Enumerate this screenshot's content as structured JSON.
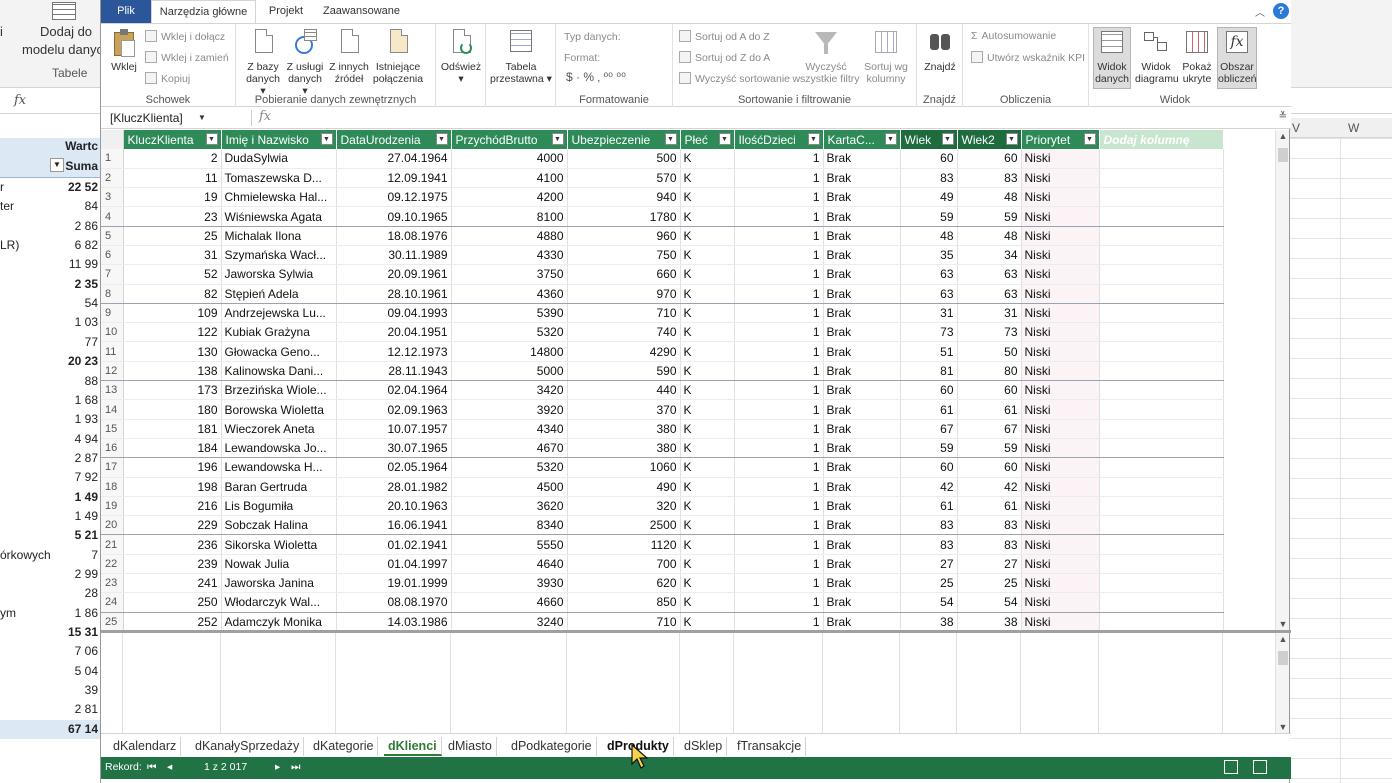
{
  "background": {
    "ribbon_partial_label": "i",
    "ribbon_button_line1": "Dodaj do",
    "ribbon_button_line2": "modelu danych",
    "ribbon_group": "Tabele",
    "fx": "fx",
    "col_w": "W",
    "pivot_header1": "Wartc",
    "pivot_header2": "Suma",
    "pivot_rows": [
      {
        "label": "r",
        "value": "22 52",
        "bold": true
      },
      {
        "label": "ter",
        "value": "84",
        "bold": false
      },
      {
        "label": "",
        "value": "2 86",
        "bold": false
      },
      {
        "label": "LR)",
        "value": "6 82",
        "bold": false
      },
      {
        "label": "",
        "value": "11 99",
        "bold": false
      },
      {
        "label": "",
        "value": "2 35",
        "bold": true
      },
      {
        "label": "",
        "value": "54",
        "bold": false
      },
      {
        "label": "",
        "value": "1 03",
        "bold": false
      },
      {
        "label": "",
        "value": "77",
        "bold": false
      },
      {
        "label": "",
        "value": "20 23",
        "bold": true
      },
      {
        "label": "",
        "value": "88",
        "bold": false
      },
      {
        "label": "",
        "value": "1 68",
        "bold": false
      },
      {
        "label": "",
        "value": "1 93",
        "bold": false
      },
      {
        "label": "",
        "value": "4 94",
        "bold": false
      },
      {
        "label": "",
        "value": "2 87",
        "bold": false
      },
      {
        "label": "",
        "value": "7 92",
        "bold": false
      },
      {
        "label": "",
        "value": "1 49",
        "bold": true
      },
      {
        "label": "",
        "value": "1 49",
        "bold": false
      },
      {
        "label": "",
        "value": "5 21",
        "bold": true
      },
      {
        "label": "órkowych",
        "value": "7",
        "bold": false
      },
      {
        "label": "",
        "value": "2 99",
        "bold": false
      },
      {
        "label": "",
        "value": "28",
        "bold": false
      },
      {
        "label": "ym",
        "value": "1 86",
        "bold": false
      },
      {
        "label": "",
        "value": "15 31",
        "bold": true
      },
      {
        "label": "",
        "value": "7 06",
        "bold": false
      },
      {
        "label": "",
        "value": "5 04",
        "bold": false
      },
      {
        "label": "",
        "value": "39",
        "bold": false
      },
      {
        "label": "",
        "value": "2 81",
        "bold": false
      },
      {
        "label": "",
        "value": "67 14",
        "bold": true
      }
    ]
  },
  "tabs": {
    "plik": "Plik",
    "home": "Narzędzia główne",
    "projekt": "Projekt",
    "zaawansowane": "Zaawansowane"
  },
  "ribbon": {
    "schowek": {
      "label": "Schowek",
      "wklej": "Wklej",
      "wklej_dolacz": "Wklej i dołącz",
      "wklej_zamien": "Wklej i zamień",
      "kopiuj": "Kopiuj"
    },
    "pobieranie": {
      "label": "Pobieranie danych zewnętrznych",
      "z_bazy": [
        "Z bazy",
        "danych"
      ],
      "z_uslugi": [
        "Z usługi",
        "danych"
      ],
      "z_innych": [
        "Z innych",
        "źródeł"
      ],
      "istniejace": [
        "Istniejące",
        "połączenia"
      ]
    },
    "odswiez": "Odśwież",
    "tabela": [
      "Tabela",
      "przestawna"
    ],
    "formatowanie": {
      "label": "Formatowanie",
      "typ": "Typ danych:",
      "format": "Format:",
      "symbols": "$ · % ‚ ⁰⁰ ⁰⁰"
    },
    "sortowanie": {
      "label": "Sortowanie i filtrowanie",
      "az": "Sortuj od A do Z",
      "za": "Sortuj od Z do A",
      "wyczysc_sort": "Wyczyść sortowanie",
      "wyczysc_filtry": [
        "Wyczyść",
        "wszystkie filtry"
      ],
      "sortuj_wg": [
        "Sortuj wg",
        "kolumny"
      ]
    },
    "znajdz": {
      "label": "Znajdź",
      "btn": "Znajdź"
    },
    "obliczenia": {
      "label": "Obliczenia",
      "autosum": "Autosumowanie",
      "kpi": "Utwórz wskaźnik KPI"
    },
    "widok": {
      "label": "Widok",
      "danych": [
        "Widok",
        "danych"
      ],
      "diagramu": [
        "Widok",
        "diagramu"
      ],
      "ukryte": [
        "Pokaż",
        "ukryte"
      ],
      "obszar": [
        "Obszar",
        "obliczeń"
      ]
    }
  },
  "formula_bar": {
    "name_box": "[KluczKlienta]",
    "fx": "fx",
    "formula": ""
  },
  "columns": [
    "KluczKlienta",
    "Imię i Nazwisko",
    "DataUrodzenia",
    "PrzychódBrutto",
    "Ubezpieczenie",
    "Płeć",
    "IlośćDzieci",
    "KartaC...",
    "Wiek",
    "Wiek2",
    "Priorytet",
    "Dodaj kolumnę"
  ],
  "rows": [
    [
      "1",
      "2",
      "DudaSylwia",
      "27.04.1964",
      "4000",
      "500",
      "K",
      "1",
      "Brak",
      "60",
      "60",
      "Niski"
    ],
    [
      "2",
      "11",
      "Tomaszewska D...",
      "12.09.1941",
      "4100",
      "570",
      "K",
      "1",
      "Brak",
      "83",
      "83",
      "Niski"
    ],
    [
      "3",
      "19",
      "Chmielewska Hal...",
      "09.12.1975",
      "4200",
      "940",
      "K",
      "1",
      "Brak",
      "49",
      "48",
      "Niski"
    ],
    [
      "4",
      "23",
      "Wiśniewska Agata",
      "09.10.1965",
      "8100",
      "1780",
      "K",
      "1",
      "Brak",
      "59",
      "59",
      "Niski"
    ],
    [
      "5",
      "25",
      "Michalak Ilona",
      "18.08.1976",
      "4880",
      "960",
      "K",
      "1",
      "Brak",
      "48",
      "48",
      "Niski"
    ],
    [
      "6",
      "31",
      "Szymańska Wacł...",
      "30.11.1989",
      "4330",
      "750",
      "K",
      "1",
      "Brak",
      "35",
      "34",
      "Niski"
    ],
    [
      "7",
      "52",
      "Jaworska Sylwia",
      "20.09.1961",
      "3750",
      "660",
      "K",
      "1",
      "Brak",
      "63",
      "63",
      "Niski"
    ],
    [
      "8",
      "82",
      "Stępień Adela",
      "28.10.1961",
      "4360",
      "970",
      "K",
      "1",
      "Brak",
      "63",
      "63",
      "Niski"
    ],
    [
      "9",
      "109",
      "Andrzejewska Lu...",
      "09.04.1993",
      "5390",
      "710",
      "K",
      "1",
      "Brak",
      "31",
      "31",
      "Niski"
    ],
    [
      "10",
      "122",
      "Kubiak Grażyna",
      "20.04.1951",
      "5320",
      "740",
      "K",
      "1",
      "Brak",
      "73",
      "73",
      "Niski"
    ],
    [
      "11",
      "130",
      "Głowacka Geno...",
      "12.12.1973",
      "14800",
      "4290",
      "K",
      "1",
      "Brak",
      "51",
      "50",
      "Niski"
    ],
    [
      "12",
      "138",
      "Kalinowska Dani...",
      "28.11.1943",
      "5000",
      "590",
      "K",
      "1",
      "Brak",
      "81",
      "80",
      "Niski"
    ],
    [
      "13",
      "173",
      "Brzezińska Wiole...",
      "02.04.1964",
      "3420",
      "440",
      "K",
      "1",
      "Brak",
      "60",
      "60",
      "Niski"
    ],
    [
      "14",
      "180",
      "Borowska Wioletta",
      "02.09.1963",
      "3920",
      "370",
      "K",
      "1",
      "Brak",
      "61",
      "61",
      "Niski"
    ],
    [
      "15",
      "181",
      "Wieczorek Aneta",
      "10.07.1957",
      "4340",
      "380",
      "K",
      "1",
      "Brak",
      "67",
      "67",
      "Niski"
    ],
    [
      "16",
      "184",
      "Lewandowska Jo...",
      "30.07.1965",
      "4670",
      "380",
      "K",
      "1",
      "Brak",
      "59",
      "59",
      "Niski"
    ],
    [
      "17",
      "196",
      "Lewandowska H...",
      "02.05.1964",
      "5320",
      "1060",
      "K",
      "1",
      "Brak",
      "60",
      "60",
      "Niski"
    ],
    [
      "18",
      "198",
      "Baran Gertruda",
      "28.01.1982",
      "4500",
      "490",
      "K",
      "1",
      "Brak",
      "42",
      "42",
      "Niski"
    ],
    [
      "19",
      "216",
      "Lis Bogumiła",
      "20.10.1963",
      "3620",
      "320",
      "K",
      "1",
      "Brak",
      "61",
      "61",
      "Niski"
    ],
    [
      "20",
      "229",
      "Sobczak Halina",
      "16.06.1941",
      "8340",
      "2500",
      "K",
      "1",
      "Brak",
      "83",
      "83",
      "Niski"
    ],
    [
      "21",
      "236",
      "Sikorska Wioletta",
      "01.02.1941",
      "5550",
      "1120",
      "K",
      "1",
      "Brak",
      "83",
      "83",
      "Niski"
    ],
    [
      "22",
      "239",
      "Nowak Julia",
      "01.04.1997",
      "4640",
      "700",
      "K",
      "1",
      "Brak",
      "27",
      "27",
      "Niski"
    ],
    [
      "23",
      "241",
      "Jaworska Janina",
      "19.01.1999",
      "3930",
      "620",
      "K",
      "1",
      "Brak",
      "25",
      "25",
      "Niski"
    ],
    [
      "24",
      "250",
      "Włodarczyk Wal...",
      "08.08.1970",
      "4660",
      "850",
      "K",
      "1",
      "Brak",
      "54",
      "54",
      "Niski"
    ],
    [
      "25",
      "252",
      "Adamczyk Monika",
      "14.03.1986",
      "3240",
      "710",
      "K",
      "1",
      "Brak",
      "38",
      "38",
      "Niski"
    ]
  ],
  "sheets": [
    "dKalendarz",
    "dKanałySprzedaży",
    "dKategorie",
    "dKlienci",
    "dMiasto",
    "dPodkategorie",
    "dProdukty",
    "dSklep",
    "fTransakcje"
  ],
  "active_sheet": "dKlienci",
  "status": {
    "rekord": "Rekord:",
    "position": "1 z 2 017"
  },
  "colors": {
    "header_green": "#2e8b57",
    "status_green": "#217346",
    "accent_blue": "#2b579a"
  }
}
